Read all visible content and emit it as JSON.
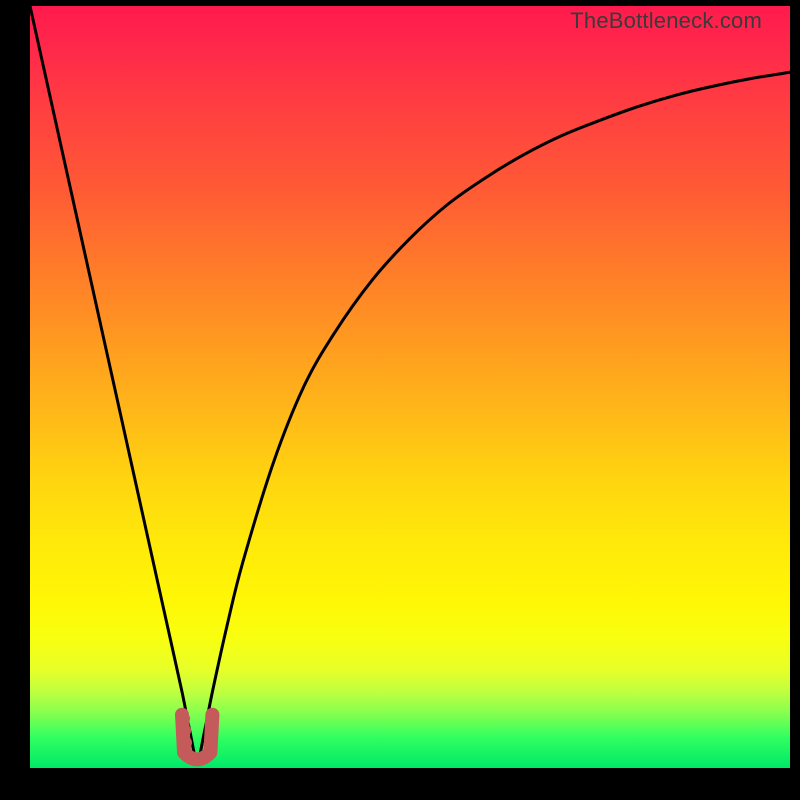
{
  "watermark": "TheBottleneck.com",
  "colors": {
    "frame": "#000000",
    "gradient_top": "#ff1a4d",
    "gradient_bottom": "#00e868",
    "curve": "#000000",
    "marker": "#c55a5a"
  },
  "chart_data": {
    "type": "line",
    "title": "",
    "xlabel": "",
    "ylabel": "",
    "xlim": [
      0,
      100
    ],
    "ylim": [
      0,
      100
    ],
    "notch_x": 22,
    "series": [
      {
        "name": "bottleneck-curve",
        "x": [
          0,
          4,
          8,
          12,
          16,
          18,
          20,
          21,
          22,
          23,
          24,
          26,
          28,
          32,
          36,
          40,
          45,
          50,
          55,
          60,
          65,
          70,
          75,
          80,
          85,
          90,
          95,
          100
        ],
        "y": [
          100,
          82,
          64,
          46,
          28,
          19,
          10,
          5,
          1,
          5,
          10,
          19,
          27,
          40,
          50,
          57,
          64,
          69.5,
          74,
          77.5,
          80.5,
          83,
          85,
          86.8,
          88.3,
          89.5,
          90.5,
          91.3
        ]
      }
    ],
    "marker": {
      "name": "optimal-range",
      "shape": "u",
      "x_range": [
        20,
        24
      ],
      "y_range": [
        1,
        7
      ]
    }
  }
}
